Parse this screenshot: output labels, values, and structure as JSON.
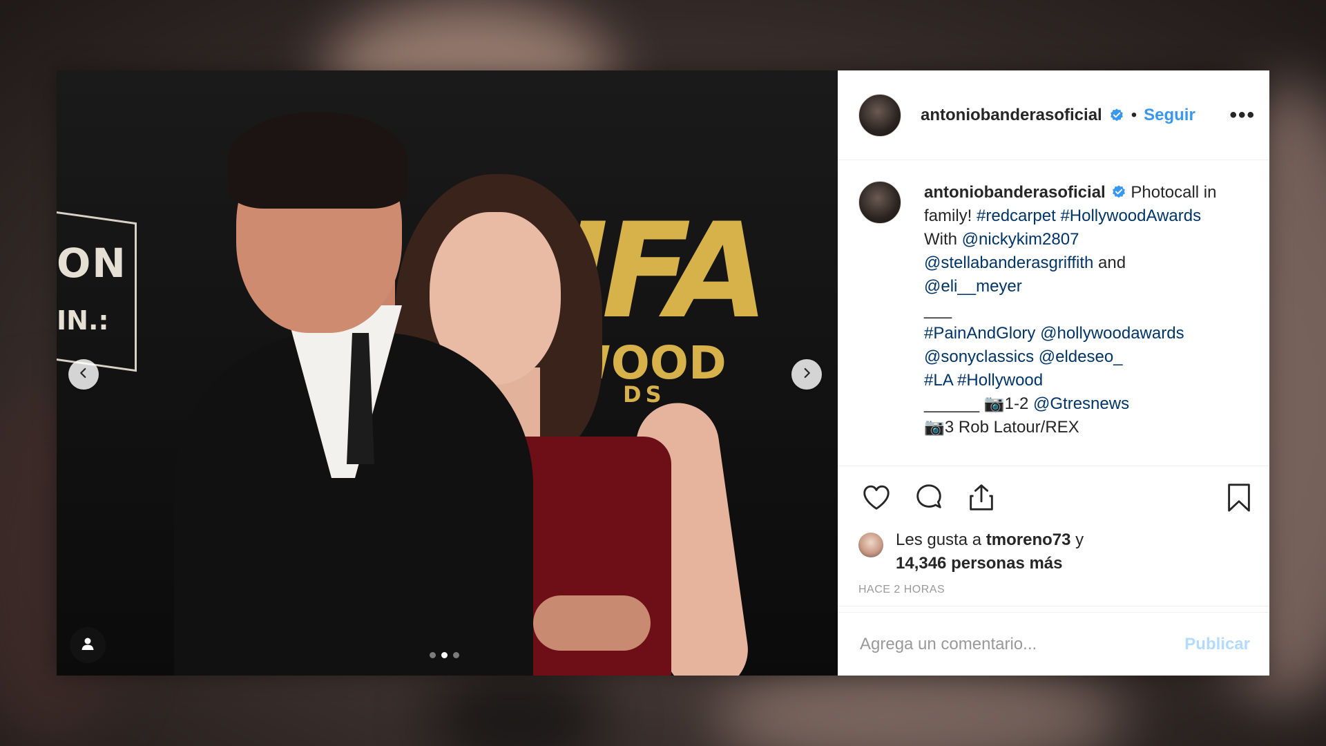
{
  "post": {
    "author": {
      "username": "antoniobanderasoficial",
      "verified": true,
      "follow_label": "Seguir",
      "separator": "•",
      "more_label": "•••"
    },
    "media": {
      "board_left_text": "ON",
      "board_left_text2": "IN.:",
      "backdrop_logo": "HFA",
      "backdrop_sub": "WOOD",
      "backdrop_sub2": "DS",
      "carousel_count": 3,
      "carousel_active_index": 1
    },
    "caption": {
      "username": "antoniobanderasoficial",
      "lines": [
        {
          "segments": [
            {
              "text": " Photocall in",
              "type": "plain"
            }
          ]
        },
        {
          "segments": [
            {
              "text": "family! ",
              "type": "plain"
            },
            {
              "text": "#redcarpet",
              "type": "link"
            },
            {
              "text": " ",
              "type": "plain"
            },
            {
              "text": "#HollywoodAwards",
              "type": "link"
            }
          ]
        },
        {
          "segments": [
            {
              "text": "With ",
              "type": "plain"
            },
            {
              "text": "@nickykim2807",
              "type": "link"
            }
          ]
        },
        {
          "segments": [
            {
              "text": "@stellabanderasgriffith",
              "type": "link"
            },
            {
              "text": " and",
              "type": "plain"
            }
          ]
        },
        {
          "segments": [
            {
              "text": "@eli__meyer",
              "type": "link"
            }
          ]
        },
        {
          "segments": [
            {
              "text": "___",
              "type": "plain"
            }
          ]
        },
        {
          "segments": [
            {
              "text": "#PainAndGlory",
              "type": "link"
            },
            {
              "text": " ",
              "type": "plain"
            },
            {
              "text": "@hollywoodawards",
              "type": "link"
            }
          ]
        },
        {
          "segments": [
            {
              "text": "@sonyclassics",
              "type": "link"
            },
            {
              "text": " ",
              "type": "plain"
            },
            {
              "text": "@eldeseo_",
              "type": "link"
            }
          ]
        },
        {
          "segments": [
            {
              "text": "#LA",
              "type": "link"
            },
            {
              "text": " ",
              "type": "plain"
            },
            {
              "text": "#Hollywood",
              "type": "link"
            }
          ]
        },
        {
          "segments": [
            {
              "text": "______ 📷1-2 ",
              "type": "plain"
            },
            {
              "text": "@Gtresnews",
              "type": "link"
            }
          ]
        },
        {
          "segments": [
            {
              "text": "📷3 Rob Latour/REX",
              "type": "plain"
            }
          ]
        }
      ]
    },
    "likes": {
      "prefix": "Les gusta a ",
      "user": "tmoreno73",
      "middle": " y",
      "count": "14,346",
      "suffix": " personas más"
    },
    "timestamp": "HACE 2 HORAS",
    "comment": {
      "placeholder": "Agrega un comentario...",
      "publish_label": "Publicar"
    },
    "icons": {
      "like": "heart-icon",
      "comment": "comment-icon",
      "share": "share-icon",
      "save": "bookmark-icon",
      "prev": "chevron-left-icon",
      "next": "chevron-right-icon",
      "tag": "user-tag-icon",
      "verified": "verified-badge-icon"
    },
    "colors": {
      "link": "#003569",
      "follow": "#3897f0",
      "publish_disabled": "#b3dbff",
      "verified": "#3897f0",
      "dress": "#6e0f17",
      "logo_gold": "#d7b24a"
    }
  }
}
